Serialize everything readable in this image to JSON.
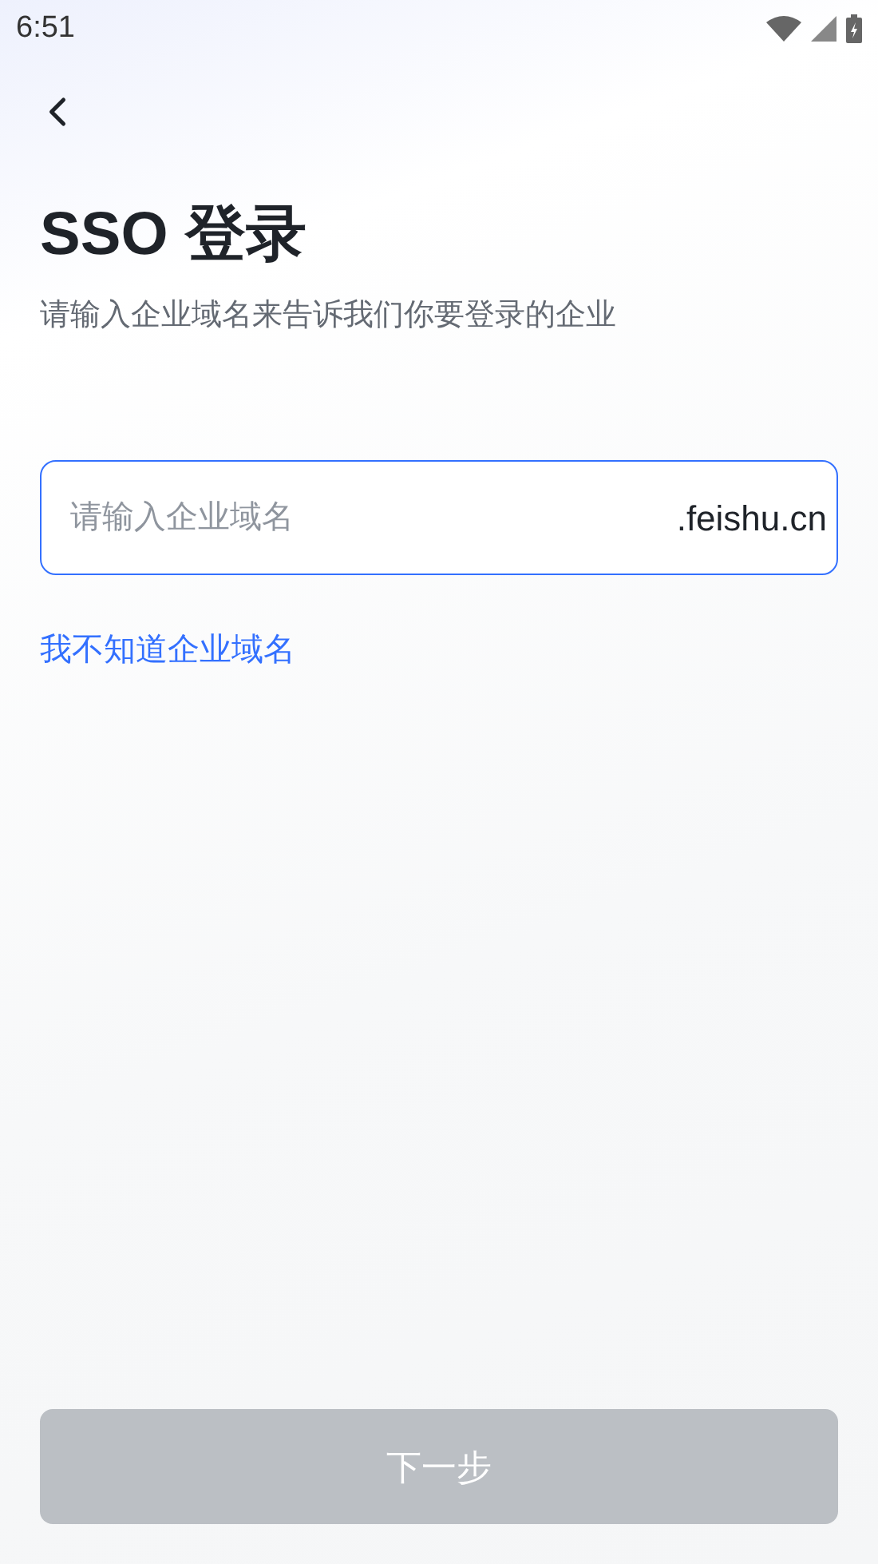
{
  "status_bar": {
    "time": "6:51"
  },
  "title": "SSO 登录",
  "subtitle": "请输入企业域名来告诉我们你要登录的企业",
  "domain_field": {
    "placeholder": "请输入企业域名",
    "suffix": ".feishu.cn",
    "focused": true
  },
  "help_link": "我不知道企业域名",
  "next_button": {
    "label": "下一步",
    "disabled": true
  }
}
